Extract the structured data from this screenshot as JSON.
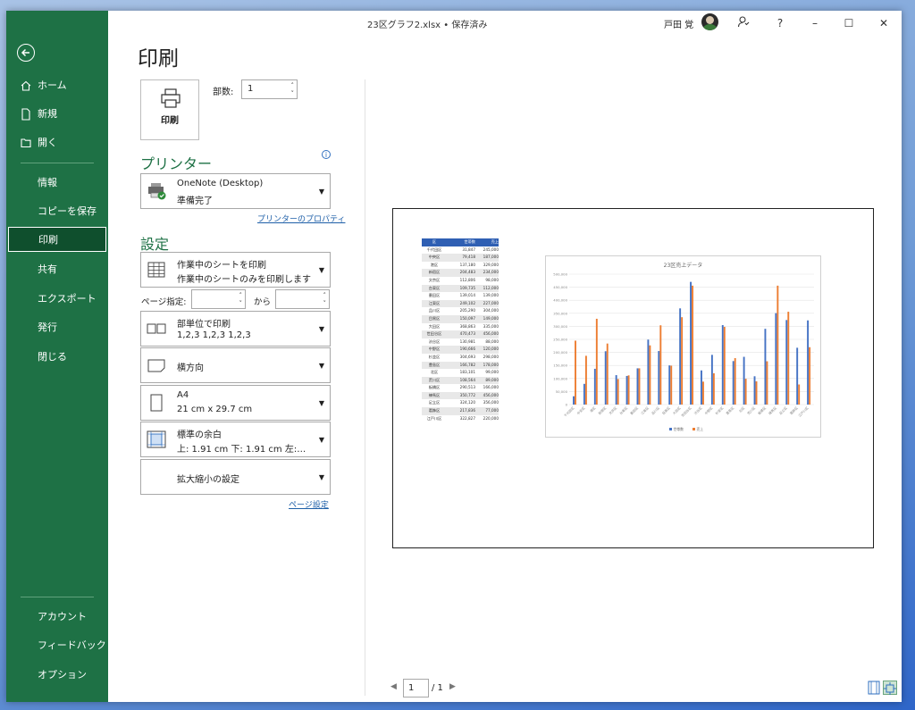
{
  "window": {
    "doc_title": "23区グラフ2.xlsx • 保存済み",
    "user_name": "戸田 覚",
    "controls": {
      "help": "?",
      "minimize": "–",
      "maximize": "☐",
      "close": "✕"
    }
  },
  "sidebar": {
    "top_items": [
      {
        "label": "ホーム",
        "icon": "home-icon"
      },
      {
        "label": "新規",
        "icon": "new-document-icon"
      },
      {
        "label": "開く",
        "icon": "folder-open-icon"
      }
    ],
    "items": [
      "情報",
      "コピーを保存",
      "印刷",
      "共有",
      "エクスポート",
      "発行",
      "閉じる"
    ],
    "active": "印刷",
    "bottom_items": [
      "アカウント",
      "フィードバック",
      "オプション"
    ]
  },
  "main": {
    "title": "印刷",
    "print_button": "印刷",
    "copies_label": "部数:",
    "copies_value": "1",
    "printer_heading": "プリンター",
    "printer": {
      "name": "OneNote (Desktop)",
      "status": "準備完了"
    },
    "printer_properties_link": "プリンターのプロパティ",
    "settings_heading": "設定",
    "settings": [
      {
        "l1": "作業中のシートを印刷",
        "l2": "作業中のシートのみを印刷します",
        "icon": "sheet-grid-icon"
      },
      {
        "l1": "部単位で印刷",
        "l2": "1,2,3    1,2,3    1,2,3",
        "icon": "collate-icon"
      },
      {
        "l1": "横方向",
        "l2": "",
        "icon": "landscape-icon"
      },
      {
        "l1": "A4",
        "l2": "21 cm x 29.7 cm",
        "icon": "paper-size-icon"
      },
      {
        "l1": "標準の余白",
        "l2": "上: 1.91 cm 下: 1.91 cm 左:…",
        "icon": "margins-icon"
      },
      {
        "l1": "拡大縮小の設定",
        "l2": "",
        "icon": ""
      }
    ],
    "pages_label": "ページ指定:",
    "pages_to_label": "から",
    "page_setup_link": "ページ設定"
  },
  "preview": {
    "current_page": "1",
    "total_pages": "/ 1",
    "table": {
      "headers": [
        "区",
        "世帯数",
        "売上"
      ],
      "rows": [
        [
          "千代田区",
          "31,847",
          "245,000"
        ],
        [
          "中央区",
          "79,418",
          "187,000"
        ],
        [
          "港区",
          "137,180",
          "329,000"
        ],
        [
          "新宿区",
          "204,483",
          "234,000"
        ],
        [
          "文京区",
          "112,806",
          "98,000"
        ],
        [
          "台東区",
          "109,735",
          "112,000"
        ],
        [
          "墨田区",
          "139,014",
          "139,000"
        ],
        [
          "江東区",
          "249,102",
          "227,000"
        ],
        [
          "品川区",
          "205,290",
          "304,000"
        ],
        [
          "目黒区",
          "150,097",
          "149,000"
        ],
        [
          "大田区",
          "368,863",
          "335,000"
        ],
        [
          "世田谷区",
          "470,473",
          "456,000"
        ],
        [
          "渋谷区",
          "130,981",
          "88,000"
        ],
        [
          "中野区",
          "190,666",
          "120,000"
        ],
        [
          "杉並区",
          "304,693",
          "298,000"
        ],
        [
          "豊島区",
          "166,782",
          "178,000"
        ],
        [
          "北区",
          "183,101",
          "99,000"
        ],
        [
          "荒川区",
          "108,564",
          "89,000"
        ],
        [
          "板橋区",
          "290,513",
          "166,000"
        ],
        [
          "練馬区",
          "350,772",
          "456,000"
        ],
        [
          "足立区",
          "324,120",
          "356,000"
        ],
        [
          "葛飾区",
          "217,836",
          "77,000"
        ],
        [
          "江戸川区",
          "322,827",
          "220,000"
        ]
      ]
    },
    "chart_data": {
      "type": "bar",
      "title": "23区売上データ",
      "categories": [
        "千代田区",
        "中央区",
        "港区",
        "新宿区",
        "文京区",
        "台東区",
        "墨田区",
        "江東区",
        "品川区",
        "目黒区",
        "大田区",
        "世田谷区",
        "渋谷区",
        "中野区",
        "杉並区",
        "豊島区",
        "北区",
        "荒川区",
        "板橋区",
        "練馬区",
        "足立区",
        "葛飾区",
        "江戸川区"
      ],
      "series": [
        {
          "name": "世帯数",
          "values": [
            31847,
            79418,
            137180,
            204483,
            112806,
            109735,
            139014,
            249102,
            205290,
            150097,
            368863,
            470473,
            130981,
            190666,
            304693,
            166782,
            183101,
            108564,
            290513,
            350772,
            324120,
            217836,
            322827
          ]
        },
        {
          "name": "売上",
          "values": [
            245000,
            187000,
            329000,
            234000,
            98000,
            112000,
            139000,
            227000,
            304000,
            149000,
            335000,
            456000,
            88000,
            120000,
            298000,
            178000,
            99000,
            89000,
            166000,
            456000,
            356000,
            77000,
            220000
          ]
        }
      ],
      "colors": [
        "#4472c4",
        "#ed7d31"
      ],
      "ylim": [
        0,
        500000
      ],
      "yticks": [
        "0",
        "50,000",
        "100,000",
        "150,000",
        "200,000",
        "250,000",
        "300,000",
        "350,000",
        "400,000",
        "450,000",
        "500,000"
      ],
      "legend": "bottom",
      "grid": true
    }
  },
  "colors": {
    "accent": "#1e7145",
    "active_nav": "#0f4f2d",
    "link": "#1e5fa8"
  }
}
